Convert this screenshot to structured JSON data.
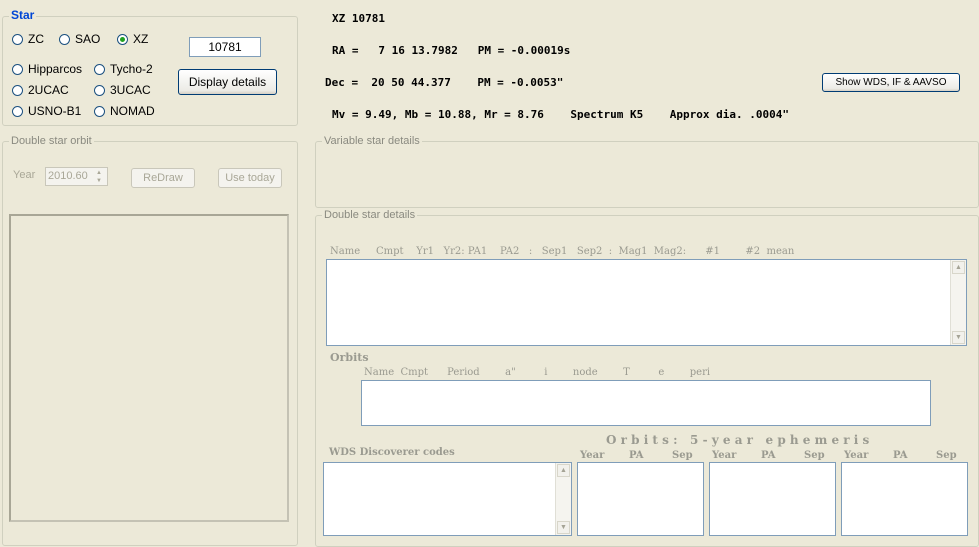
{
  "star_group": {
    "title": "Star",
    "radios": [
      {
        "label": "ZC",
        "checked": false
      },
      {
        "label": "SAO",
        "checked": false
      },
      {
        "label": "XZ",
        "checked": true
      },
      {
        "label": "Hipparcos",
        "checked": false
      },
      {
        "label": "Tycho-2",
        "checked": false
      },
      {
        "label": "2UCAC",
        "checked": false
      },
      {
        "label": "3UCAC",
        "checked": false
      },
      {
        "label": "USNO-B1",
        "checked": false
      },
      {
        "label": "NOMAD",
        "checked": false
      }
    ],
    "number_value": "10781",
    "display_button": "Display details"
  },
  "orbit_group": {
    "title": "Double star orbit",
    "year_label": "Year",
    "year_value": "2010.60",
    "redraw_button": "ReDraw",
    "use_today_button": "Use today"
  },
  "star_info": {
    "name": "XZ 10781",
    "ra_line": "RA =   7 16 13.7982   PM = -0.00019s",
    "dec_line": "Dec =  20 50 44.377    PM = -0.0053\"",
    "mag_line": "Mv = 9.49, Mb = 10.88, Mr = 8.76    Spectrum K5    Approx dia. .0004\""
  },
  "wds_button": "Show WDS, IF & AAVSO",
  "variable_group": {
    "title": "Variable star details"
  },
  "double_group": {
    "title": "Double star details",
    "columns_header": "Name     Cmpt    Yr1   Yr2: PA1    PA2   :   Sep1   Sep2  :  Mag1  Mag2:      #1        #2  mean",
    "orbits_label": "Orbits",
    "orbits_header": "Name  Cmpt      Period        a\"         i        node        T         e        peri",
    "wds_codes_label": "WDS Discoverer codes",
    "ephemeris_title": "O r b i t s :   5 - y e a r   e p h e m e r i s",
    "ephemeris_cols": [
      "Year",
      "PA",
      "Sep"
    ]
  }
}
